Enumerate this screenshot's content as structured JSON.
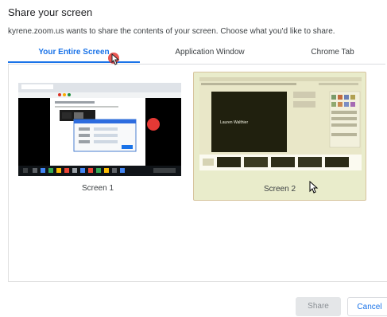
{
  "dialog": {
    "title": "Share your screen",
    "subtitle": "kyrene.zoom.us wants to share the contents of your screen. Choose what you'd like to share."
  },
  "tabs": [
    {
      "label": "Your Entire Screen",
      "active": true
    },
    {
      "label": "Application Window",
      "active": false
    },
    {
      "label": "Chrome Tab",
      "active": false
    }
  ],
  "screens": [
    {
      "label": "Screen 1",
      "selected": false
    },
    {
      "label": "Screen 2",
      "selected": true
    }
  ],
  "screen2_thumb_text": "Lauren Walthier",
  "buttons": {
    "share": "Share",
    "cancel": "Cancel"
  },
  "colors": {
    "accent": "#1a73e8",
    "selected_bg": "#e9eccb",
    "selected_border": "#d7c49e"
  }
}
